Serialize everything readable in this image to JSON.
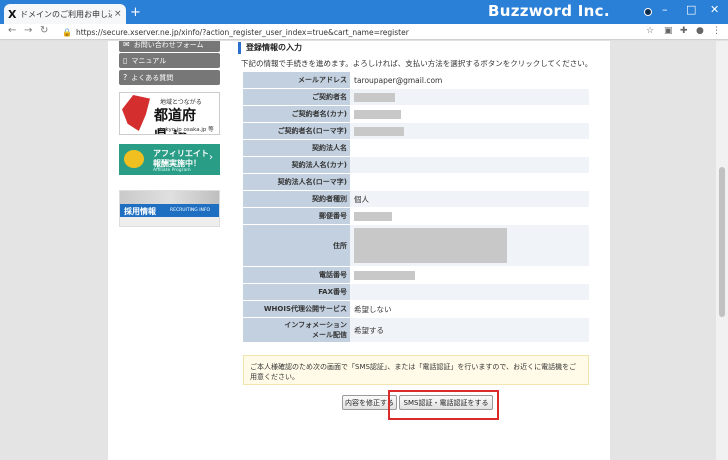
{
  "browser": {
    "tab_title": "ドメインのご利用お申し込み | 独自ドメ",
    "tab_favicon": "X",
    "tab_close": "×",
    "new_tab": "+",
    "brand": "Buzzword Inc.",
    "url": "https://secure.xserver.ne.jp/xinfo/?action_register_user_index=true&cart_name=register",
    "window_controls": [
      "–",
      "□",
      "✕"
    ]
  },
  "sidebar": {
    "items": [
      {
        "icon": "mail-icon",
        "glyph": "✉",
        "label": "お問い合わせフォーム"
      },
      {
        "icon": "book-icon",
        "glyph": "📖",
        "label": "マニュアル"
      },
      {
        "icon": "question-icon",
        "glyph": "?",
        "label": "よくある質問"
      }
    ],
    "banner_prefecture": {
      "line1": "地域とつながる",
      "line2": "都道府県.jp",
      "line3": "tokyo.jp osaka.jp 等"
    },
    "banner_affiliate": {
      "line1": "アフィリエイト",
      "line2": "報酬実施中！",
      "line3": "Affiliate Program"
    },
    "banner_recruit": {
      "line1": "採用情報",
      "line2": "RECRUITING INFO"
    }
  },
  "main": {
    "section_title": "登録情報の入力",
    "intro": "下記の情報で手続きを進めます。よろしければ、支払い方法を選択するボタンをクリックしてください。",
    "rows": [
      {
        "label": "メールアドレス",
        "value": "taroupaper@gmail.com"
      },
      {
        "label": "ご契約者名",
        "value": ""
      },
      {
        "label": "ご契約者名(カナ)",
        "value": ""
      },
      {
        "label": "ご契約者名(ローマ字)",
        "value": ""
      },
      {
        "label": "契約法人名",
        "value": ""
      },
      {
        "label": "契約法人名(カナ)",
        "value": ""
      },
      {
        "label": "契約法人名(ローマ字)",
        "value": ""
      },
      {
        "label": "契約者種別",
        "value": "個人"
      },
      {
        "label": "郵便番号",
        "value": ""
      },
      {
        "label": "住所",
        "value": ""
      },
      {
        "label": "電話番号",
        "value": ""
      },
      {
        "label": "FAX番号",
        "value": ""
      },
      {
        "label": "WHOIS代理公開サービス",
        "value": "希望しない"
      },
      {
        "label_line1": "インフォメーション",
        "label_line2": "メール配信",
        "value": "希望する"
      }
    ],
    "notice": "ご本人様確認のため次の画面で「SMS認証」、または「電話認証」を行いますので、お近くに電話機をご用意ください。",
    "buttons": {
      "edit": "内容を修正する",
      "verify": "SMS認証・電話認証をする"
    },
    "highlight_color": "#d92b2b"
  }
}
